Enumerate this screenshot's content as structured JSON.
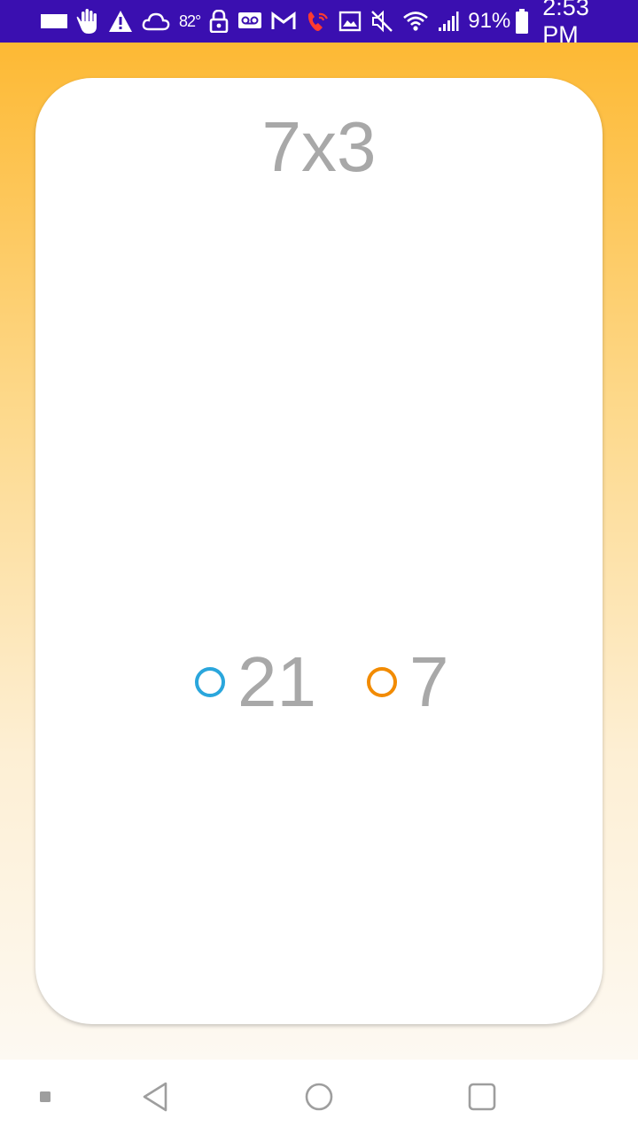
{
  "status_bar": {
    "temperature": "82°",
    "battery_text": "91%",
    "time": "2:53 PM",
    "icons": [
      "window-icon",
      "hand-icon",
      "warning-icon",
      "cloud-icon",
      "lock-icon",
      "voicemail-icon",
      "gmail-icon",
      "wifi-calling-icon",
      "image-icon",
      "mute-icon",
      "wifi-icon",
      "signal-icon",
      "battery-icon"
    ]
  },
  "quiz": {
    "question": "7x3",
    "options": [
      {
        "label": "21",
        "color": "#2aa6dc"
      },
      {
        "label": "7",
        "color": "#f28b00"
      }
    ]
  },
  "theme": {
    "status_bar_color": "#3a0fb0",
    "gradient_top": "#fdb934",
    "gradient_bottom": "#fdf9f2",
    "text_color": "#a8a8a8"
  },
  "nav_bar": {
    "icons": [
      "menu-dot-icon",
      "back-icon",
      "home-icon",
      "recents-icon"
    ]
  }
}
